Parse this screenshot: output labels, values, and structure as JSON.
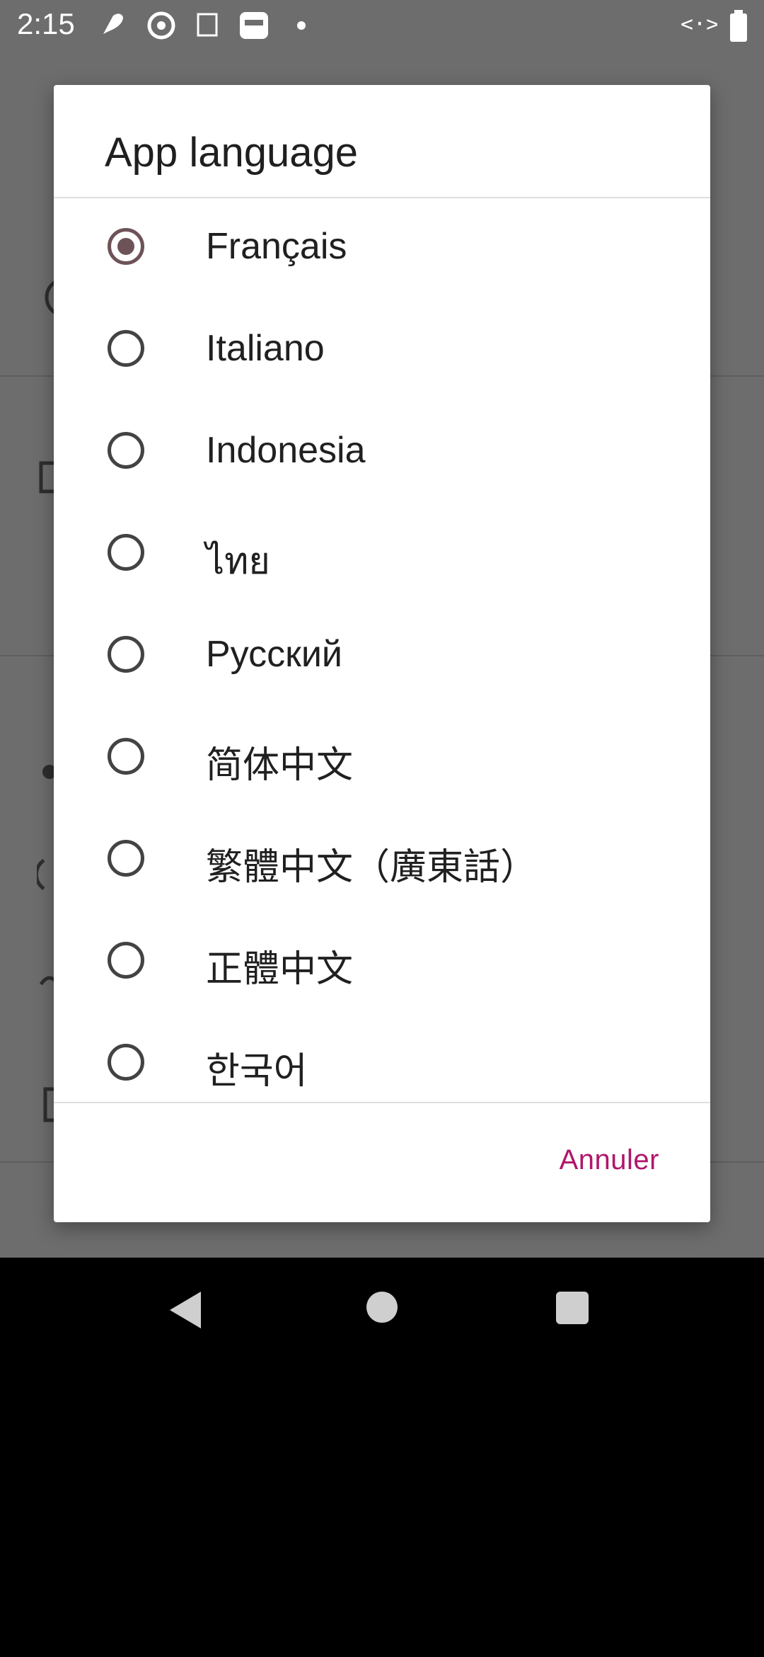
{
  "status_bar": {
    "time": "2:15",
    "notification_icons": [
      "feather-icon",
      "target-icon",
      "app-icon",
      "face-icon",
      "dot-icon"
    ],
    "right_icons": [
      "data-saver-icon",
      "battery-icon"
    ]
  },
  "dialog": {
    "title": "App language",
    "options": [
      {
        "label": "Français",
        "checked": true
      },
      {
        "label": "Italiano",
        "checked": false
      },
      {
        "label": "Indonesia",
        "checked": false
      },
      {
        "label": "ไทย",
        "checked": false
      },
      {
        "label": "Русский",
        "checked": false
      },
      {
        "label": "简体中文",
        "checked": false
      },
      {
        "label": "繁體中文（廣東話）",
        "checked": false
      },
      {
        "label": "正體中文",
        "checked": false
      },
      {
        "label": "한국어",
        "checked": false
      }
    ],
    "cancel_label": "Annuler"
  },
  "colors": {
    "accent": "#b0166b",
    "radio_checked": "#6d5358",
    "scrim": "#6d6d6d"
  }
}
